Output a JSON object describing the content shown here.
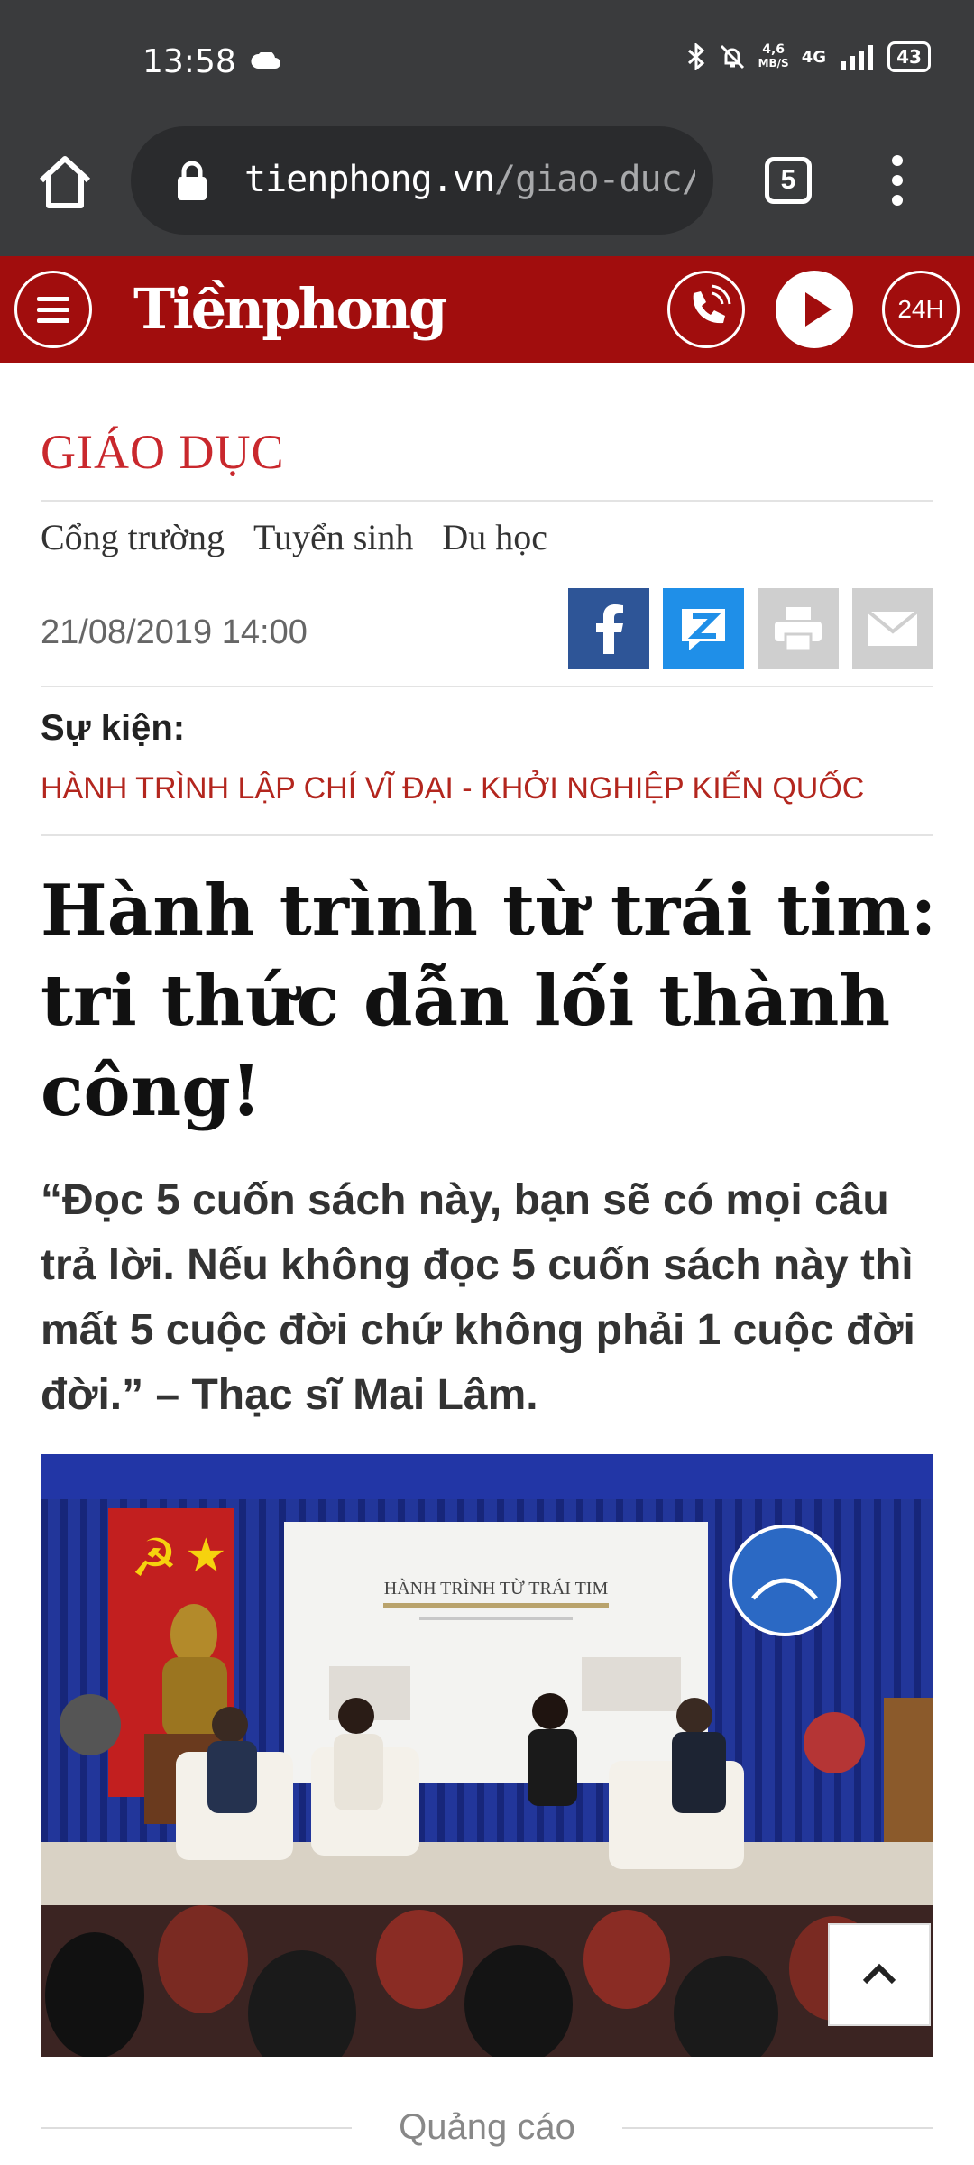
{
  "status_bar": {
    "time": "13:58",
    "net_speed_value": "4,6",
    "net_speed_unit": "MB/S",
    "network_type": "4G",
    "battery": "43"
  },
  "browser": {
    "url_domain": "tienphong.vn",
    "url_path": "/giao-duc/ha",
    "tab_count": "5"
  },
  "site_header": {
    "logo": "Tiềnphong",
    "badge_24h": "24H"
  },
  "article": {
    "section": "GIÁO DỤC",
    "subnav": [
      "Cổng trường",
      "Tuyển sinh",
      "Du học"
    ],
    "date": "21/08/2019 14:00",
    "event_label": "Sự kiện:",
    "event_title": "HÀNH TRÌNH LẬP CHÍ VĨ ĐẠI - KHỞI NGHIỆP KIẾN QUỐC",
    "headline": "Hành trình từ trái tim: tri thức dẫn lối thành công!",
    "sapo": "“Đọc 5 cuốn sách này, bạn sẽ có mọi câu trả lời. Nếu không đọc 5 cuốn sách này thì mất 5 cuộc đời chứ không phải 1 cuộc đời đời.” – Thạc sĩ Mai Lâm.",
    "photo_banner": "HÀNH TRÌNH TỪ TRÁI TIM"
  },
  "ad_label": "Quảng cáo",
  "colors": {
    "brand_red": "#a10d0d",
    "section_red": "#c9282d",
    "facebook": "#2e5597",
    "zalo": "#1f8fe8",
    "chrome_dark": "#3a3b3d"
  }
}
